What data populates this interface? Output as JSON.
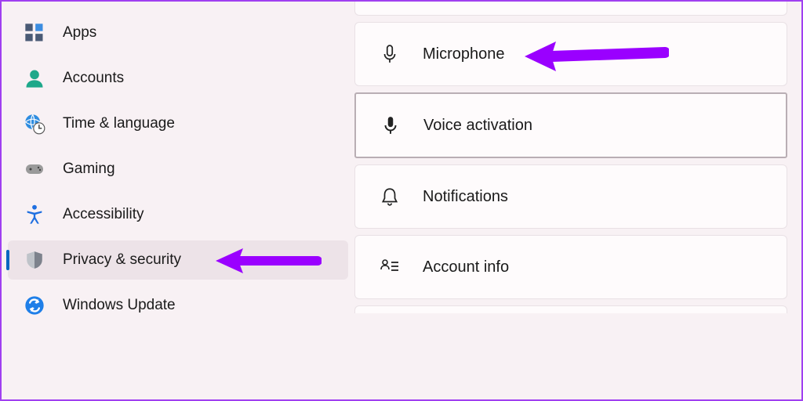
{
  "sidebar": {
    "items": [
      {
        "label": "Apps",
        "icon": "apps-icon"
      },
      {
        "label": "Accounts",
        "icon": "person-icon"
      },
      {
        "label": "Time & language",
        "icon": "globe-clock-icon"
      },
      {
        "label": "Gaming",
        "icon": "gamepad-icon"
      },
      {
        "label": "Accessibility",
        "icon": "accessibility-icon"
      },
      {
        "label": "Privacy & security",
        "icon": "shield-icon",
        "selected": true
      },
      {
        "label": "Windows Update",
        "icon": "sync-icon"
      }
    ]
  },
  "main": {
    "cards": [
      {
        "label": "Microphone",
        "icon": "mic-outline-icon",
        "annotated": true
      },
      {
        "label": "Voice activation",
        "icon": "mic-filled-icon",
        "highlight": true
      },
      {
        "label": "Notifications",
        "icon": "bell-icon"
      },
      {
        "label": "Account info",
        "icon": "account-list-icon"
      }
    ]
  },
  "annotations": {
    "arrow_color": "#9a00ff"
  }
}
